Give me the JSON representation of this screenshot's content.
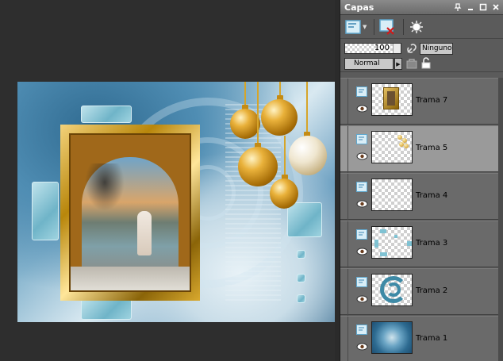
{
  "panel": {
    "title": "Capas",
    "opacity": "100",
    "mask_mode": "Ninguno",
    "blend_mode": "Normal",
    "layers": [
      {
        "name": "Trama 7",
        "selected": false,
        "thumb": "frame-icon"
      },
      {
        "name": "Trama 5",
        "selected": true,
        "thumb": "ornaments-icon"
      },
      {
        "name": "Trama 4",
        "selected": false,
        "thumb": "empty"
      },
      {
        "name": "Trama 3",
        "selected": false,
        "thumb": "tiles-icon"
      },
      {
        "name": "Trama 2",
        "selected": false,
        "thumb": "swirl-icon"
      },
      {
        "name": "Trama 1",
        "selected": false,
        "thumb": "background-icon"
      }
    ]
  },
  "icons": {
    "pin": "pin-icon",
    "minimize": "minimize-icon",
    "maximize": "maximize-icon",
    "close": "close-icon",
    "new_layer": "new-raster-layer-icon",
    "delete_layer": "delete-layer-icon",
    "layer_effects": "layer-effects-icon",
    "link": "link-icon",
    "lock": "lock-icon",
    "visibility": "eye-icon"
  },
  "colors": {
    "panel_bg": "#5b5b5b",
    "selected_row": "#9a9a9a",
    "workspace_bg": "#2e2e2e"
  }
}
